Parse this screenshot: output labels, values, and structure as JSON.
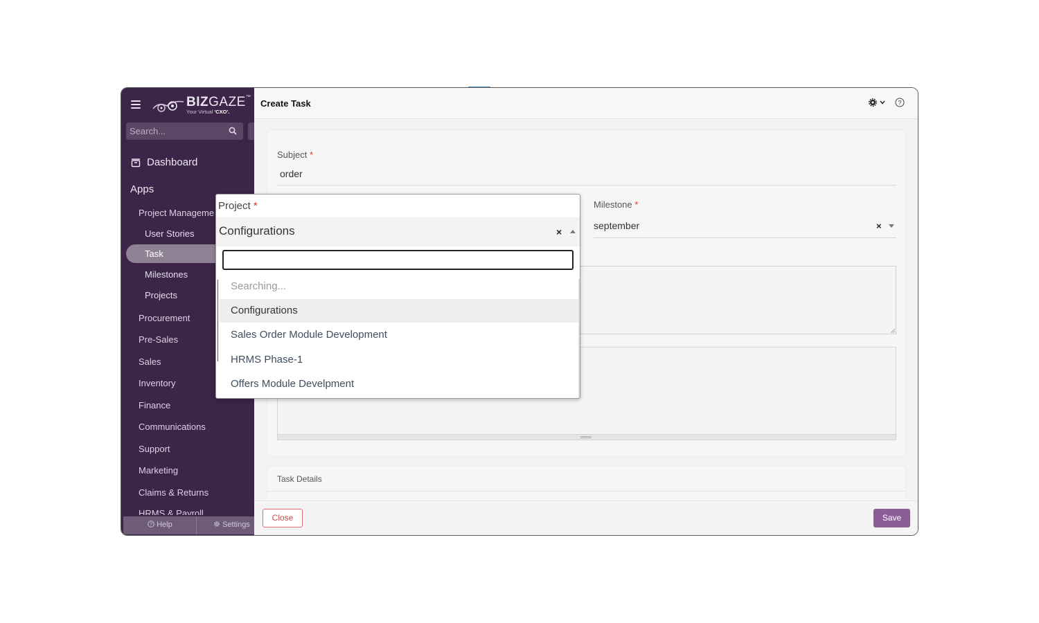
{
  "sidebar": {
    "logo": {
      "brand_bold": "BIZ",
      "brand_light": "GAZE",
      "tagline_prefix": "Your Virtual ",
      "tagline_bold": "'CXO'."
    },
    "search_placeholder": "Search...",
    "dashboard_label": "Dashboard",
    "apps_label": "Apps",
    "items": [
      {
        "label": "Project Manageme"
      },
      {
        "label": "User Stories"
      },
      {
        "label": "Task",
        "active": true
      },
      {
        "label": "Milestones"
      },
      {
        "label": "Projects"
      },
      {
        "label": "Procurement"
      },
      {
        "label": "Pre-Sales"
      },
      {
        "label": "Sales"
      },
      {
        "label": "Inventory"
      },
      {
        "label": "Finance"
      },
      {
        "label": "Communications"
      },
      {
        "label": "Support"
      },
      {
        "label": "Marketing"
      },
      {
        "label": "Claims & Returns"
      },
      {
        "label": "HRMS & Payroll"
      }
    ],
    "footer": {
      "help_label": "Help",
      "settings_label": "Settings"
    }
  },
  "main": {
    "title": "Create Task",
    "form": {
      "subject_label": "Subject",
      "subject_value": "order",
      "milestone_label": "Milestone",
      "milestone_value": "september",
      "required_mark": "*"
    },
    "details_title": "Task Details",
    "close_label": "Close",
    "save_label": "Save"
  },
  "project_dropdown": {
    "label": "Project",
    "required_mark": "*",
    "selected": "Configurations",
    "search_value": "",
    "status_text": "Searching...",
    "options": [
      {
        "label": "Configurations",
        "highlighted": true
      },
      {
        "label": "Sales Order Module Development"
      },
      {
        "label": "HRMS Phase-1"
      },
      {
        "label": "Offers Module Develpment"
      }
    ]
  },
  "colors": {
    "sidebar_bg": "#3c2548",
    "accent": "#8c5d99",
    "close_red": "#d04848",
    "required_red": "#dd3333"
  }
}
